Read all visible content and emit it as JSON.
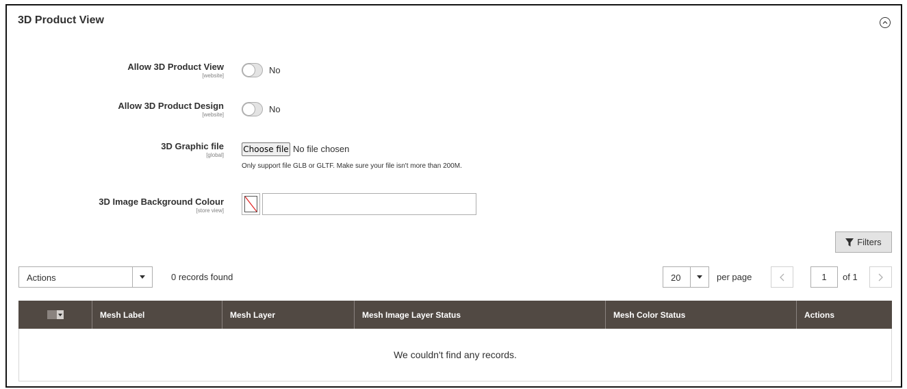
{
  "section": {
    "title": "3D Product View",
    "collapse_icon": "chevron-up-circle-icon"
  },
  "fields": {
    "allow_view": {
      "label": "Allow 3D Product View",
      "scope": "[website]",
      "value": "No"
    },
    "allow_design": {
      "label": "Allow 3D Product Design",
      "scope": "[website]",
      "value": "No"
    },
    "graphic_file": {
      "label": "3D Graphic file",
      "scope": "[global]",
      "button": "Choose file",
      "status": "No file chosen",
      "note": "Only support file GLB or GLTF. Make sure your file isn't more than 200M."
    },
    "bg_colour": {
      "label": "3D Image Background Colour",
      "scope": "[store view]",
      "value": ""
    }
  },
  "toolbar": {
    "filters_label": "Filters",
    "actions_label": "Actions",
    "records_found": "0 records found",
    "per_page_value": "20",
    "per_page_label": "per page",
    "page_current": "1",
    "page_of": "of 1"
  },
  "grid": {
    "columns": [
      "Mesh Label",
      "Mesh Layer",
      "Mesh Image Layer Status",
      "Mesh Color Status",
      "Actions"
    ],
    "empty_message": "We couldn't find any records."
  },
  "colors": {
    "header_bg": "#514943",
    "accent_red": "#e22626"
  }
}
